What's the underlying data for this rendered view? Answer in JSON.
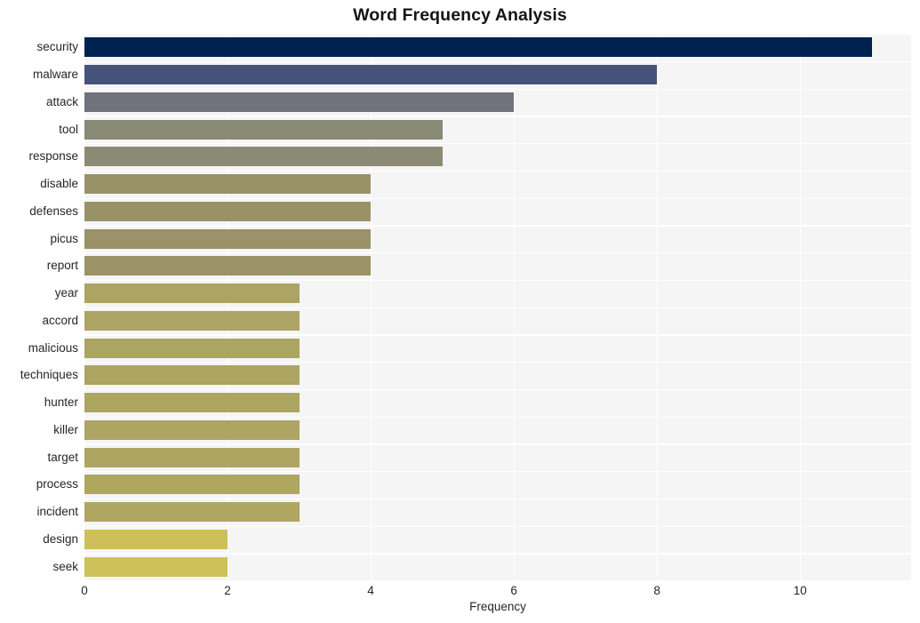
{
  "chart_data": {
    "type": "bar",
    "orientation": "horizontal",
    "title": "Word Frequency Analysis",
    "xlabel": "Frequency",
    "ylabel": "",
    "categories": [
      "security",
      "malware",
      "attack",
      "tool",
      "response",
      "disable",
      "defenses",
      "picus",
      "report",
      "year",
      "accord",
      "malicious",
      "techniques",
      "hunter",
      "killer",
      "target",
      "process",
      "incident",
      "design",
      "seek"
    ],
    "values": [
      11,
      8,
      6,
      5,
      5,
      4,
      4,
      4,
      4,
      3,
      3,
      3,
      3,
      3,
      3,
      3,
      3,
      3,
      2,
      2
    ],
    "xlim": [
      0,
      11.55
    ],
    "xticks": [
      0,
      2,
      4,
      6,
      8,
      10
    ],
    "xtick_labels": [
      "0",
      "2",
      "4",
      "6",
      "8",
      "10"
    ],
    "grid": true,
    "legend": false,
    "colormap": "cividis",
    "bar_colors": [
      "#00224e",
      "#47527a",
      "#71727c",
      "#888a76",
      "#8b8a74",
      "#989268",
      "#999268",
      "#9a9268",
      "#9b9367",
      "#aba463",
      "#aca463",
      "#aca462",
      "#ada562",
      "#ada562",
      "#aea562",
      "#aea562",
      "#afa661",
      "#afa661",
      "#cdc05a",
      "#cec15a"
    ],
    "plot_background": "#f5f5f6",
    "grid_color": "#ffffff",
    "figure_background": "#ffffff"
  }
}
